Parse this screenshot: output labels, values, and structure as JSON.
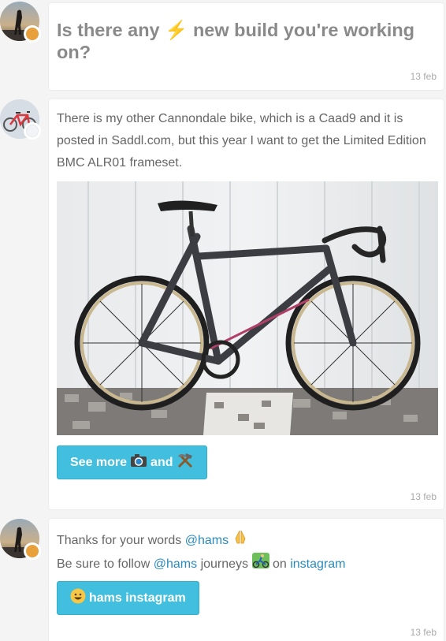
{
  "messages": [
    {
      "heading_before": "Is there any",
      "heading_after": "new build you're working",
      "heading_line2": "on?",
      "date": "13 feb"
    },
    {
      "text_line1": "There is my other Cannondale bike, which is a Caad9 and it is",
      "text_line2": "posted in Saddl.com, but this year I want to get the Limited Edition",
      "text_line3": "BMC ALR01 frameset.",
      "button_see_more": "See more",
      "button_and": "and",
      "date": "13 feb"
    },
    {
      "line1_before": "Thanks for your words",
      "line1_mention": "@hams",
      "line2_before": "Be sure to follow",
      "line2_mention": "@hams",
      "line2_middle": "journeys",
      "line2_on": "on",
      "line2_link": "instagram",
      "button_label": "hams instagram",
      "date": "13 feb"
    }
  ],
  "icons": {
    "bolt": "high-voltage-emoji",
    "camera": "camera-emoji",
    "tools": "hammer-and-pick-emoji",
    "pray": "folded-hands-emoji",
    "biker": "mountain-biker-emoji",
    "smile": "grinning-face-emoji",
    "avatar_badge": "sun-badge-icon"
  },
  "colors": {
    "button": "#42bede",
    "link": "#2b8bbb",
    "heading": "#8a8a8a",
    "background": "#f4f4f4"
  }
}
